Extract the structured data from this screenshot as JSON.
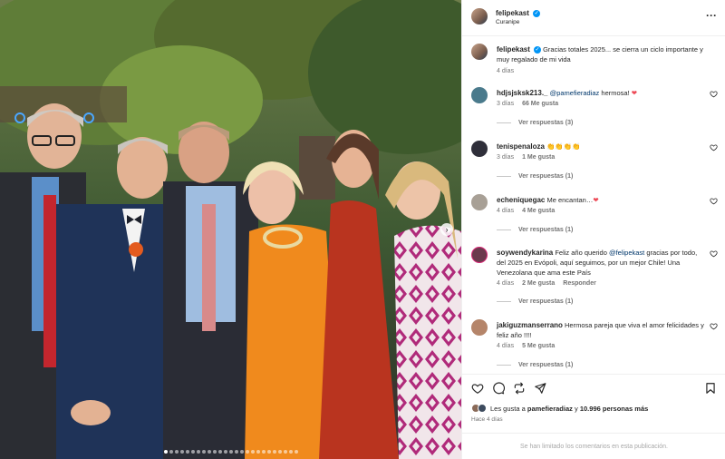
{
  "post": {
    "username": "felipekast",
    "location": "Curanipe",
    "caption_user": "felipekast",
    "caption": "Gracias totales 2025... se cierra un ciclo importante y muy regalado de mi vida",
    "caption_time": "4 días",
    "more_icon": "more-horizontal-icon",
    "verified_icon": "verified-badge-icon"
  },
  "photo": {
    "total_slides": 25,
    "active_slide": 1,
    "next_icon": "chevron-right-icon"
  },
  "comments": [
    {
      "username": "hdjsjsksk213._",
      "mention": "@pamefieradiaz",
      "text": " hermosa! ",
      "emoji": "❤",
      "time": "3 días",
      "likes": "66 Me gusta",
      "reply": "",
      "replies": "Ver respuestas (3)",
      "avatar_color": "#4a7a8c"
    },
    {
      "username": "tenispenaloza",
      "mention": "",
      "text": "",
      "emoji": "👏👏👏👏",
      "time": "3 días",
      "likes": "1 Me gusta",
      "reply": "",
      "replies": "Ver respuestas (1)",
      "avatar_color": "#2f2f3a"
    },
    {
      "username": "echeniquegac",
      "mention": "",
      "text": "Me encantan…",
      "emoji": "❤",
      "time": "4 días",
      "likes": "4 Me gusta",
      "reply": "",
      "replies": "Ver respuestas (1)",
      "avatar_color": "#a8a096"
    },
    {
      "username": "soywendykarina",
      "mention": "@felipekast",
      "text_before": "Feliz año querido ",
      "text": " gracias por todo, del 2025 en Evópoli, aquí seguimos, por un mejor Chile! Una Venezolana que ama este País",
      "emoji": "",
      "time": "4 días",
      "likes": "2 Me gusta",
      "reply": "Responder",
      "replies": "Ver respuestas (1)",
      "avatar_color": "#6b3a4d"
    },
    {
      "username": "jakiguzmanserrano",
      "mention": "",
      "text": "Hermosa pareja que viva el amor felicidades y feliz año !!!!",
      "emoji": "",
      "time": "4 días",
      "likes": "5 Me gusta",
      "reply": "",
      "replies": "Ver respuestas (1)",
      "avatar_color": "#b5856a"
    }
  ],
  "actions": {
    "like_icon": "heart-outline-icon",
    "comment_icon": "comment-bubble-icon",
    "repost_icon": "repost-icon",
    "share_icon": "send-paper-plane-icon",
    "save_icon": "bookmark-icon",
    "likes_prefix": "Les gusta a ",
    "likes_user": "pamefieradiaz",
    "likes_mid": " y ",
    "likes_count": "10.996 personas más",
    "time": "Hace 4 días",
    "comments_limited": "Se han limitado los comentarios en esta publicación."
  },
  "colors": {
    "accent_link": "#00376b",
    "verified_blue": "#0095f6",
    "heart_red": "#ed4956",
    "secondary_text": "#737373"
  }
}
